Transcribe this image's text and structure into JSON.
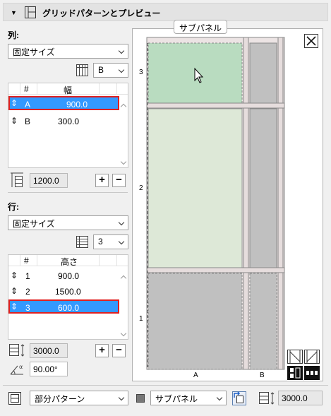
{
  "header": {
    "title": "グリッドパターンとプレビュー"
  },
  "columns": {
    "label": "列:",
    "mode": "固定サイズ",
    "count_value": "B",
    "table_headers": [
      "#",
      "幅"
    ],
    "rows": [
      {
        "id": "A",
        "value": "900.0",
        "selected": true
      },
      {
        "id": "B",
        "value": "300.0",
        "selected": false
      }
    ],
    "total": "1200.0"
  },
  "rows_section": {
    "label": "行:",
    "mode": "固定サイズ",
    "count_value": "3",
    "table_headers": [
      "#",
      "高さ"
    ],
    "rows": [
      {
        "id": "1",
        "value": "900.0",
        "selected": false
      },
      {
        "id": "2",
        "value": "1500.0",
        "selected": false
      },
      {
        "id": "3",
        "value": "600.0",
        "selected": true
      }
    ],
    "total": "3000.0",
    "angle": "90.00°"
  },
  "preview": {
    "tooltip": "サブパネル",
    "row_labels": [
      "3",
      "2",
      "1"
    ],
    "col_labels": [
      "A",
      "B"
    ]
  },
  "bottom": {
    "pattern_select": "部分パターン",
    "panel_select": "サブパネル",
    "total_height": "3000.0"
  },
  "colors": {
    "selection": "#3399ff",
    "highlight_border": "#e02020",
    "cell_selected": "#b9dcc0",
    "cell_light": "#dde8d7",
    "cell_gray": "#c0c0c0"
  }
}
